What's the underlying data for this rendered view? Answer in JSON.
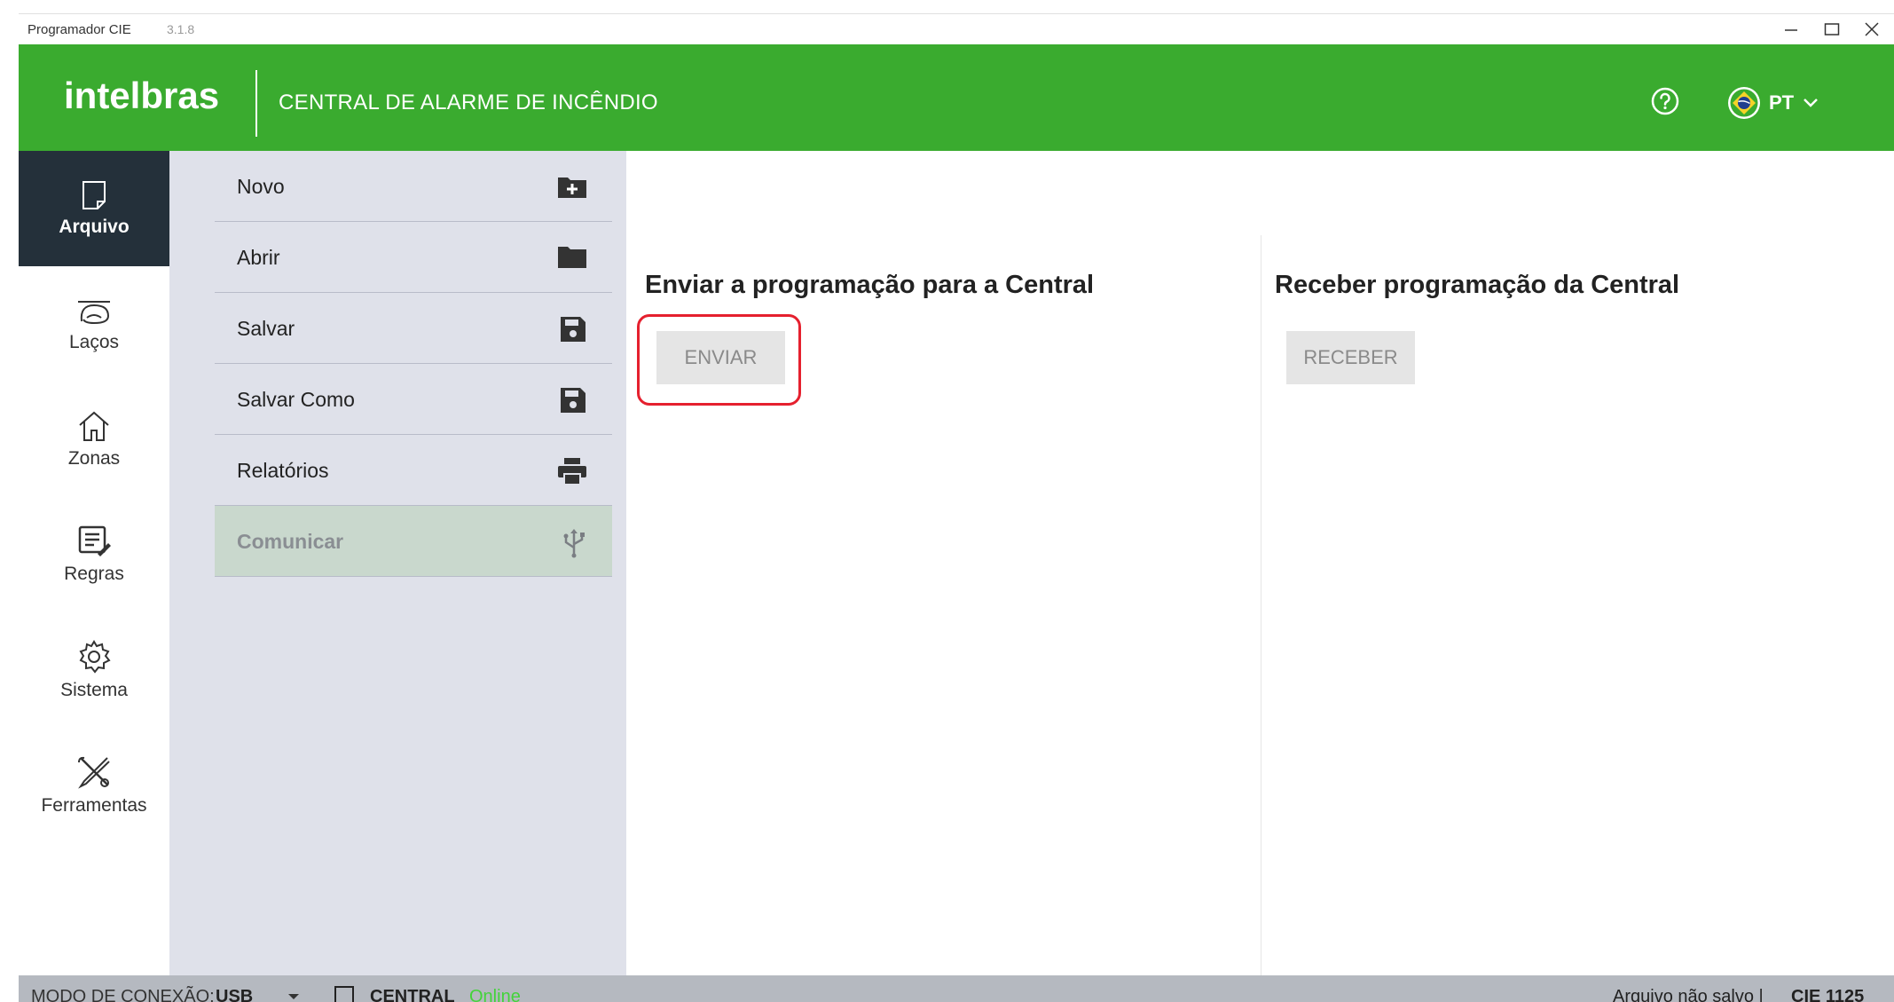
{
  "window": {
    "app_name": "Programador CIE",
    "version": "3.1.8"
  },
  "header": {
    "logo_text": "intelbras",
    "subtitle": "CENTRAL DE ALARME DE INCÊNDIO",
    "language": "PT",
    "brand_color": "#3aab2f"
  },
  "rail": {
    "items": [
      {
        "label": "Arquivo",
        "icon": "file-icon"
      },
      {
        "label": "Laços",
        "icon": "detector-icon"
      },
      {
        "label": "Zonas",
        "icon": "home-icon"
      },
      {
        "label": "Regras",
        "icon": "rules-icon"
      },
      {
        "label": "Sistema",
        "icon": "gear-icon"
      },
      {
        "label": "Ferramentas",
        "icon": "tools-icon"
      }
    ]
  },
  "submenu": {
    "items": [
      {
        "label": "Novo",
        "icon": "new-folder-icon"
      },
      {
        "label": "Abrir",
        "icon": "folder-icon"
      },
      {
        "label": "Salvar",
        "icon": "save-icon"
      },
      {
        "label": "Salvar Como",
        "icon": "save-as-icon"
      },
      {
        "label": "Relatórios",
        "icon": "printer-icon"
      },
      {
        "label": "Comunicar",
        "icon": "usb-icon"
      }
    ]
  },
  "main": {
    "send": {
      "title": "Enviar a programação para a Central",
      "button": "ENVIAR"
    },
    "receive": {
      "title": "Receber programação da Central",
      "button": "RECEBER"
    }
  },
  "status": {
    "mode_label": "MODO DE CONEXÃO:",
    "mode_value": "USB",
    "central_label": "CENTRAL",
    "central_status": "Online",
    "file_status": "Arquivo não salvo |",
    "model": "CIE 1125"
  }
}
